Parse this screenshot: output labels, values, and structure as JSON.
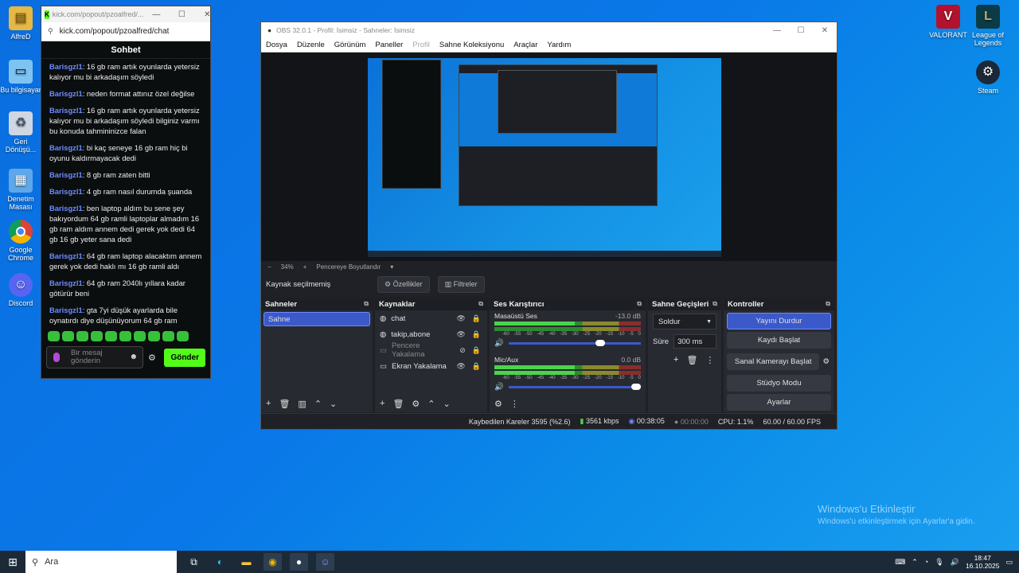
{
  "desktop": {
    "icons_left": [
      {
        "label": "AlfreD"
      },
      {
        "label": "Bu bilgisayar"
      },
      {
        "label": "Geri Dönüşü..."
      },
      {
        "label": "Denetim Masası"
      },
      {
        "label": "Google Chrome"
      },
      {
        "label": "Discord"
      }
    ],
    "icons_right": [
      {
        "label": "VALORANT"
      },
      {
        "label": "League of Legends"
      },
      {
        "label": "Steam"
      }
    ],
    "watermark": {
      "title": "Windows'u Etkinleştir",
      "subtitle": "Windows'u etkinleştirmek için Ayarlar'a gidin."
    }
  },
  "chat": {
    "window_title": "kick.com/popout/pzoalfred/...",
    "url": "kick.com/popout/pzoalfred/chat",
    "header": "Sohbet",
    "messages": [
      {
        "user": "Barisgzl1",
        "text": ": 16 gb ram artık oyunlarda yetersiz kalıyor mu bi arkadaşım söyledi"
      },
      {
        "user": "Barisgzl1",
        "text": ": neden format attınız özel değilse"
      },
      {
        "user": "Barisgzl1",
        "text": ": 16 gb ram artık oyunlarda yetersiz kalıyor mu bi arkadaşım söyledi bilginiz varmı bu konuda tahmininizce falan"
      },
      {
        "user": "Barisgzl1",
        "text": ": bi kaç seneye 16 gb ram hiç bi oyunu kaldırmayacak dedi"
      },
      {
        "user": "Barisgzl1",
        "text": ": 8 gb ram zaten bitti"
      },
      {
        "user": "Barisgzl1",
        "text": ": 4 gb ram nasıl durumda şuanda"
      },
      {
        "user": "Barisgzl1",
        "text": ": ben laptop aldım bu sene şey bakıyordum 64 gb ramli laptoplar almadım 16 gb ram aldım annem dedi gerek yok dedi 64 gb 16 gb yeter sana dedi"
      },
      {
        "user": "Barisgzl1",
        "text": ": 64 gb ram laptop alacaktım annem gerek yok dedi haklı mı 16 gb ramli aldı"
      },
      {
        "user": "Barisgzl1",
        "text": ": 64 gb ram 2040lı yıllara kadar götürür beni"
      },
      {
        "user": "Barisgzl1",
        "text": ": gta 7yi düşük ayarlarda bile oynatırdı diye düşünüyorum 64 gb ram"
      }
    ],
    "input_placeholder": "Bir mesaj gönderin",
    "send_label": "Gönder"
  },
  "obs": {
    "title": "OBS 32.0.1 - Profil: İsimsiz - Sahneler: İsimsiz",
    "menu": [
      "Dosya",
      "Düzenle",
      "Görünüm",
      "Paneller",
      "Profil",
      "Sahne Koleksiyonu",
      "Araçlar",
      "Yardım"
    ],
    "zoom": "34%",
    "zoom_mode": "Pencereye Boyutlandır",
    "no_source": "Kaynak seçilmemiş",
    "properties": "Özellikler",
    "filters": "Filtreler",
    "scenes_title": "Sahneler",
    "scenes": [
      "Sahne"
    ],
    "sources_title": "Kaynaklar",
    "sources": [
      {
        "name": "chat",
        "dim": false
      },
      {
        "name": "takip,abone",
        "dim": false
      },
      {
        "name": "Pencere Yakalama",
        "dim": true
      },
      {
        "name": "Ekran Yakalama",
        "dim": false
      }
    ],
    "mixer_title": "Ses Karıştırıcı",
    "mixer": [
      {
        "name": "Masaüstü Ses",
        "db": "-13.0 dB",
        "level": 0.73
      },
      {
        "name": "Mic/Aux",
        "db": "0.0 dB",
        "level": 1.0
      }
    ],
    "meter_ticks": [
      "-60",
      "-55",
      "-50",
      "-45",
      "-40",
      "-35",
      "-30",
      "-25",
      "-20",
      "-15",
      "-10",
      "-5",
      "0"
    ],
    "transitions_title": "Sahne Geçişleri",
    "transition": "Soldur",
    "duration_label": "Süre",
    "duration": "300 ms",
    "controls_title": "Kontroller",
    "controls": [
      "Yayını Durdur",
      "Kaydı Başlat",
      "Sanal Kamerayı Başlat",
      "Stüdyo Modu",
      "Ayarlar"
    ],
    "status": {
      "dropped": "Kaybedilen Kareler 3595 (%2.6)",
      "bitrate": "3561 kbps",
      "stream_time": "00:38:05",
      "rec_time": "00:00:00",
      "cpu": "CPU: 1.1%",
      "fps": "60.00 / 60.00 FPS"
    }
  },
  "taskbar": {
    "search": "Ara",
    "time": "18:47",
    "date": "16.10.2025"
  }
}
